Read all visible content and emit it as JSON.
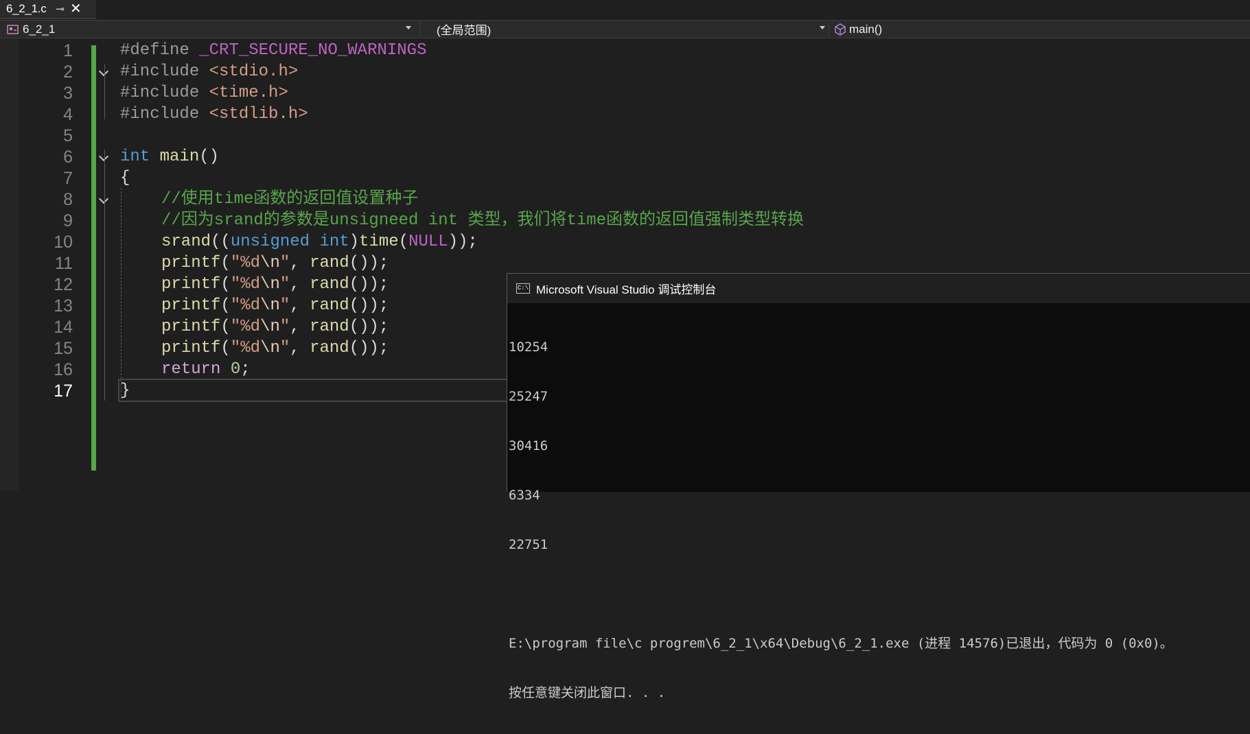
{
  "tab": {
    "title": "6_2_1.c",
    "pin": "⊸",
    "close": "✕"
  },
  "navbar": {
    "project": "6_2_1",
    "scope": "(全局范围)",
    "member": "main()"
  },
  "editor": {
    "line_numbers": [
      "1",
      "2",
      "3",
      "4",
      "5",
      "6",
      "7",
      "8",
      "9",
      "10",
      "11",
      "12",
      "13",
      "14",
      "15",
      "16",
      "17"
    ],
    "current_line": "17"
  },
  "code": {
    "l1": {
      "pp": "#define",
      "macro": "_CRT_SECURE_NO_WARNINGS"
    },
    "l2": {
      "pp": "#include",
      "hdr": "<stdio.h>"
    },
    "l3": {
      "pp": "#include",
      "hdr": "<time.h>"
    },
    "l4": {
      "pp": "#include",
      "hdr": "<stdlib.h>"
    },
    "l6": {
      "kw": "int",
      "fn": "main",
      "rest": "()"
    },
    "l7": {
      "text": "{"
    },
    "l8": {
      "comment": "//使用time函数的返回值设置种子"
    },
    "l9": {
      "comment": "//因为srand的参数是unsigneed int 类型，我们将time函数的返回值强制类型转换"
    },
    "l10": {
      "fn": "srand",
      "p1": "((",
      "kw1": "unsigned",
      "sp": " ",
      "kw2": "int",
      "p2": ")",
      "fn2": "time",
      "p3": "(",
      "macro": "NULL",
      "p4": "));"
    },
    "printf": {
      "fn": "printf",
      "open": "(",
      "str1": "\"%d",
      "esc": "\\n",
      "str2": "\"",
      "comma": ", ",
      "fn2": "rand",
      "close": "());"
    },
    "l16": {
      "ctl": "return",
      "num": "0",
      "end": ";"
    },
    "l17": {
      "text": "}"
    }
  },
  "console": {
    "title": "Microsoft Visual Studio 调试控制台",
    "icon_label": "C:\\",
    "lines": [
      "10254",
      "25247",
      "30416",
      "6334",
      "22751",
      "",
      "E:\\program file\\c progrem\\6_2_1\\x64\\Debug\\6_2_1.exe (进程 14576)已退出，代码为 0 (0x0)。",
      "按任意键关闭此窗口. . ."
    ]
  },
  "colors": {
    "background": "#1f1f1f",
    "change_bar": "#57a64a",
    "keyword": "#569cd6",
    "function": "#dcdcaa",
    "comment": "#57a64a",
    "string": "#d69d85",
    "macro": "#bd63c5"
  },
  "icons": {
    "project": "project-icon",
    "member": "cube-icon",
    "console": "console-icon"
  }
}
